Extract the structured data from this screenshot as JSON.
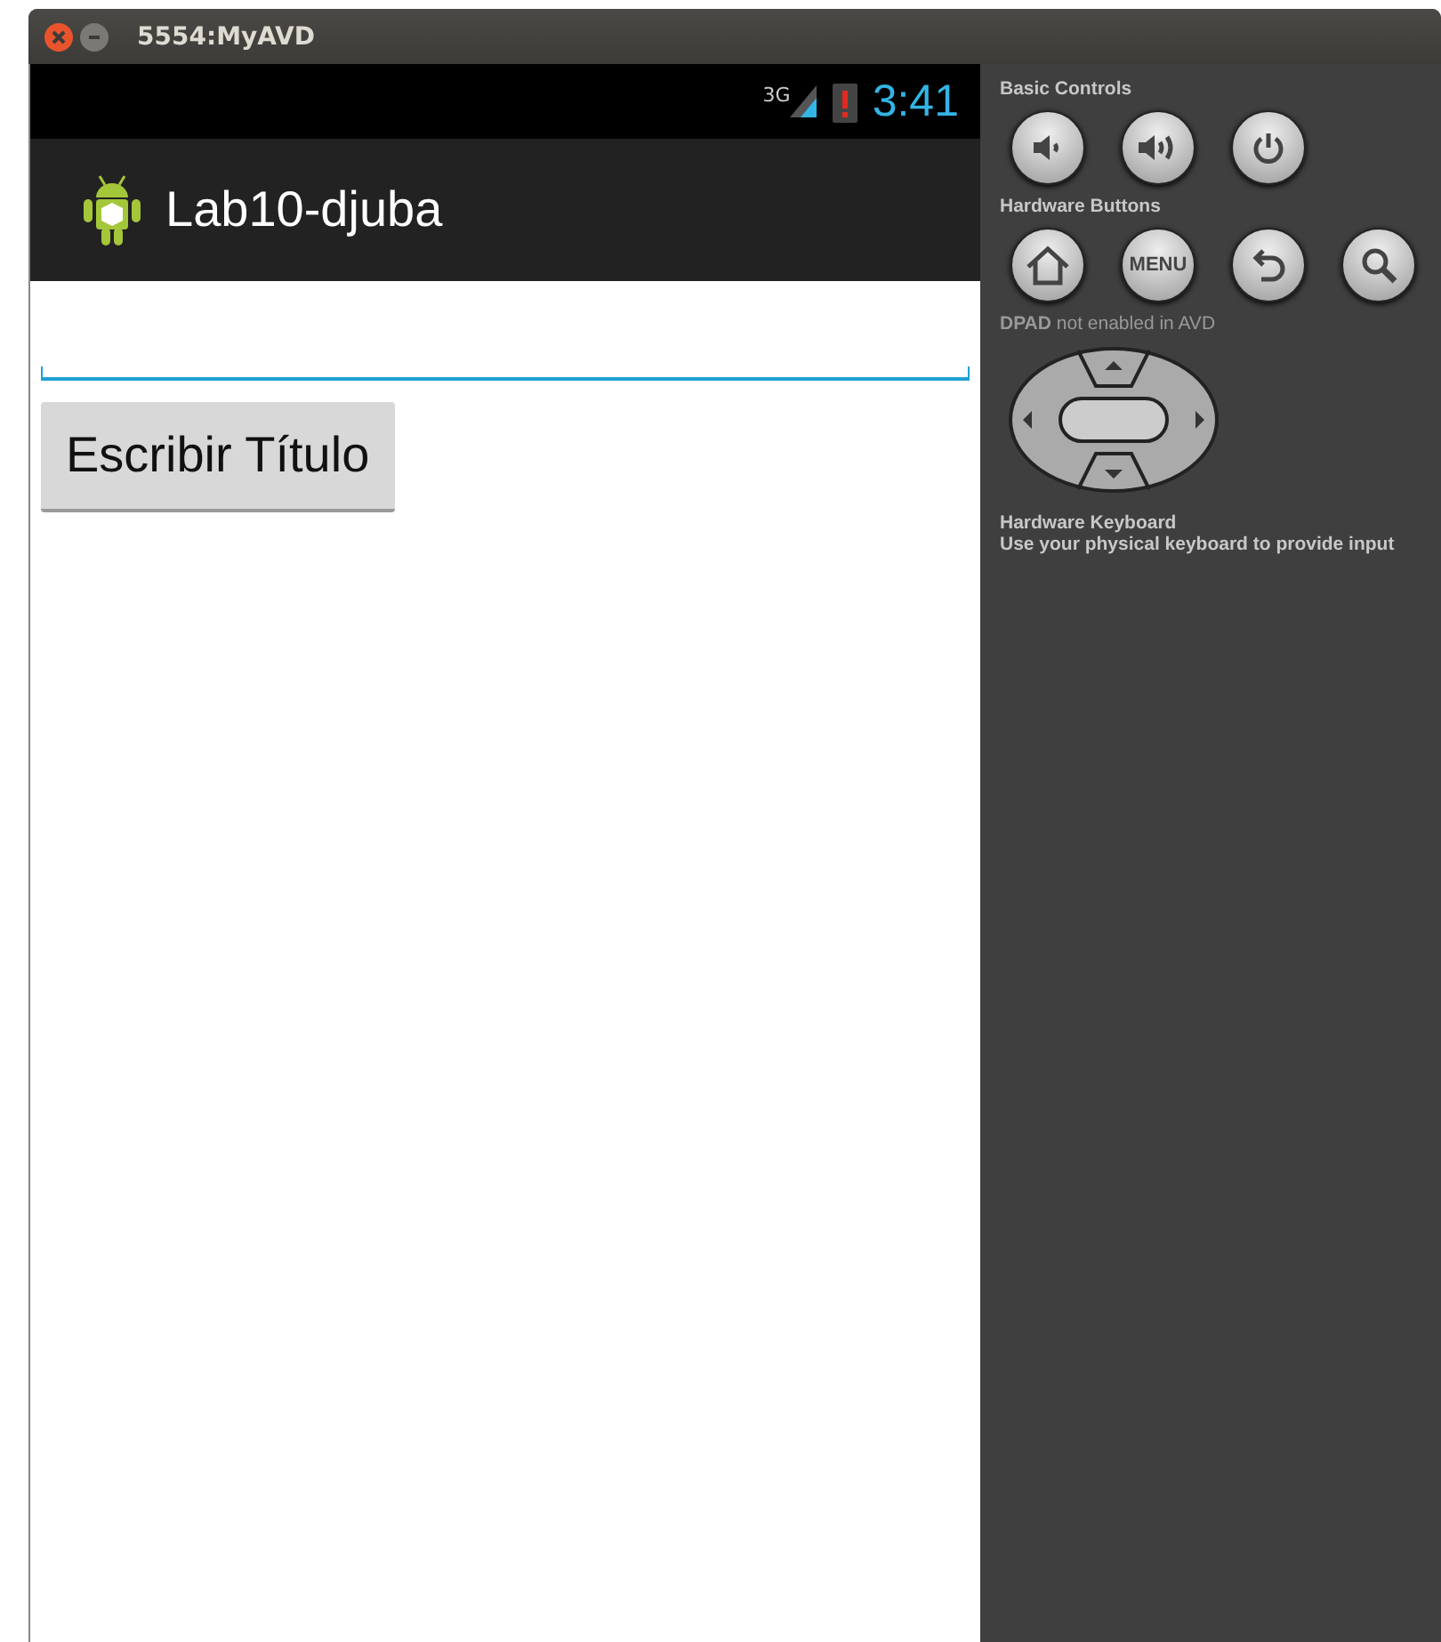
{
  "window": {
    "title": "5554:MyAVD"
  },
  "status_bar": {
    "network": "3G",
    "time": "3:41"
  },
  "action_bar": {
    "title": "Lab10-djuba"
  },
  "content": {
    "text_field": {
      "focused": true
    },
    "button": "Escribir Título"
  },
  "panel": {
    "basic_controls": {
      "label": "Basic Controls",
      "buttons": [
        {
          "kind": "volume-down"
        },
        {
          "kind": "volume-up"
        },
        {
          "kind": "power"
        }
      ]
    },
    "hardware_buttons": {
      "label": "Hardware Buttons",
      "buttons": [
        {
          "kind": "home"
        },
        {
          "kind": "menu",
          "text": "MENU"
        },
        {
          "kind": "back"
        },
        {
          "kind": "search"
        }
      ]
    },
    "dpad": {
      "label": "**DPAD** not enabled in AVD"
    },
    "keyboard": {
      "title": "Hardware Keyboard",
      "text": "Use your physical keyboard to provide input"
    }
  }
}
